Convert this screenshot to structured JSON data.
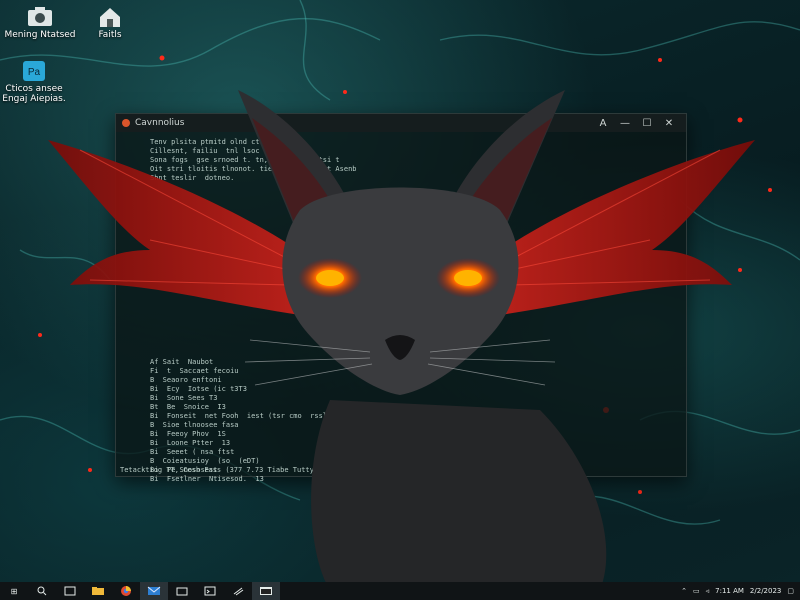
{
  "desktop": {
    "icons": [
      {
        "label": "Mening Ntatsed"
      },
      {
        "label": "Faitls"
      },
      {
        "label": "Cticos ansee\nEngaj Aiepias."
      }
    ]
  },
  "window": {
    "title": "Cavnnolius",
    "controls": {
      "help": "A",
      "minimize": "—",
      "maximize": "☐",
      "close": "✕"
    },
    "console_lines_top": [
      "Tenv plsita ptmitd olnd ctoenng",
      "Cillesnt, failiu  tnl lsoc ctoefgmtb",
      "",
      "Sona fogs  gse srnoed t. tn, fmsaie nst tsi t",
      "Oit stri tloitis tlnonot. tie. pioaue. rest Asenb",
      "Shnt teslir  dotneo."
    ],
    "console_lines_bottom": [
      "Af Sait  Naubot",
      "Fi  t  Saccaet fecoiu",
      "B  Seaoro enftoni",
      "Bi  Ecy  Iotse (ic t3T3",
      "Bi  Sone Sees T3",
      "Bt  Be  Snoice  I3",
      "",
      "Bi  Fonseit  net Fooh  iest (tsr cmo  rsslo",
      "B  Sioe tlnoosee fasa",
      "Bi  Feeoy Phov  1S",
      "Bi  Loone Ptter  13",
      "Bi  Seeet ( nsa ftst",
      "B  Coieatusioy  (so  (eDT)",
      "Bi  Pe Snososest",
      "Bi  Fsetlner  Ntisesod.  13"
    ],
    "status_line": "Tetacktiog TT, Cesh Fass (377 7.73 Tiabe Tuttys)"
  },
  "taskbar": {
    "start_label": "⊞",
    "apps": [
      "search",
      "task-view",
      "file-explorer",
      "browser",
      "mail",
      "store",
      "terminal",
      "settings"
    ],
    "tray": {
      "time": "7:11 AM",
      "date": "2/2/2023"
    }
  },
  "colors": {
    "accent": "#e8261e",
    "eye": "#ff6a00",
    "wallpaper": "#0b2a2e",
    "taskbar": "#101416"
  }
}
